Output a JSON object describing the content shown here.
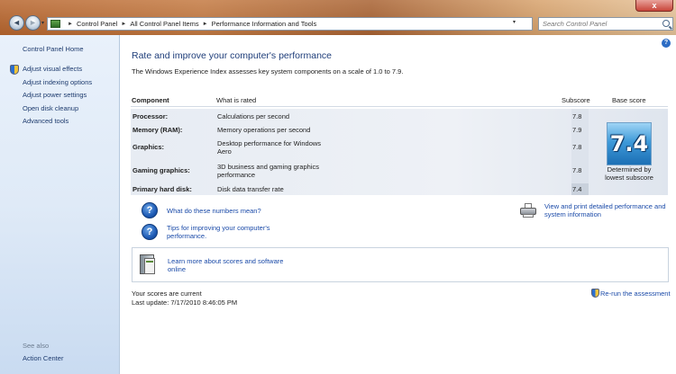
{
  "window": {
    "close_glyph": "x"
  },
  "nav": {
    "back_glyph": "◄",
    "forward_glyph": "►",
    "dropdown_glyph": "▾",
    "breadcrumb": [
      "Control Panel",
      "All Control Panel Items",
      "Performance Information and Tools"
    ],
    "separator_glyph": "►",
    "refresh_glyph": "↻",
    "search_placeholder": "Search Control Panel"
  },
  "sidebar": {
    "home": "Control Panel Home",
    "items": [
      {
        "label": "Adjust visual effects",
        "icon": "uac-shield-icon"
      },
      {
        "label": "Adjust indexing options"
      },
      {
        "label": "Adjust power settings"
      },
      {
        "label": "Open disk cleanup"
      },
      {
        "label": "Advanced tools"
      }
    ],
    "see_also_label": "See also",
    "see_also_items": [
      {
        "label": "Action Center"
      }
    ]
  },
  "main": {
    "help_glyph": "?",
    "title": "Rate and improve your computer's performance",
    "intro": "The Windows Experience Index assesses key system components on a scale of 1.0 to 7.9.",
    "columns": {
      "component": "Component",
      "rated": "What is rated",
      "subscore": "Subscore",
      "base": "Base score"
    },
    "rows": [
      {
        "component": "Processor:",
        "rated": "Calculations per second",
        "subscore": "7.8"
      },
      {
        "component": "Memory (RAM):",
        "rated": "Memory operations per second",
        "subscore": "7.9"
      },
      {
        "component": "Graphics:",
        "rated": "Desktop performance for Windows Aero",
        "subscore": "7.8"
      },
      {
        "component": "Gaming graphics:",
        "rated": "3D business and gaming graphics performance",
        "subscore": "7.8"
      },
      {
        "component": "Primary hard disk:",
        "rated": "Disk data transfer rate",
        "subscore": "7.4"
      }
    ],
    "base_score": "7.4",
    "base_caption": "Determined by lowest subscore",
    "links": {
      "numbers_meaning": "What do these numbers mean?",
      "tips": "Tips for improving your computer's performance.",
      "print": "View and print detailed performance and system information",
      "learn_more": "Learn more about scores and software online"
    },
    "question_glyph": "?",
    "status": {
      "current": "Your scores are current",
      "last_update": "Last update: 7/17/2010 8:46:05 PM"
    },
    "rerun": "Re-run the assessment"
  },
  "colors": {
    "link": "#1a4aa8",
    "title": "#1f3e7a",
    "score_tile": "#3e9ad9"
  }
}
